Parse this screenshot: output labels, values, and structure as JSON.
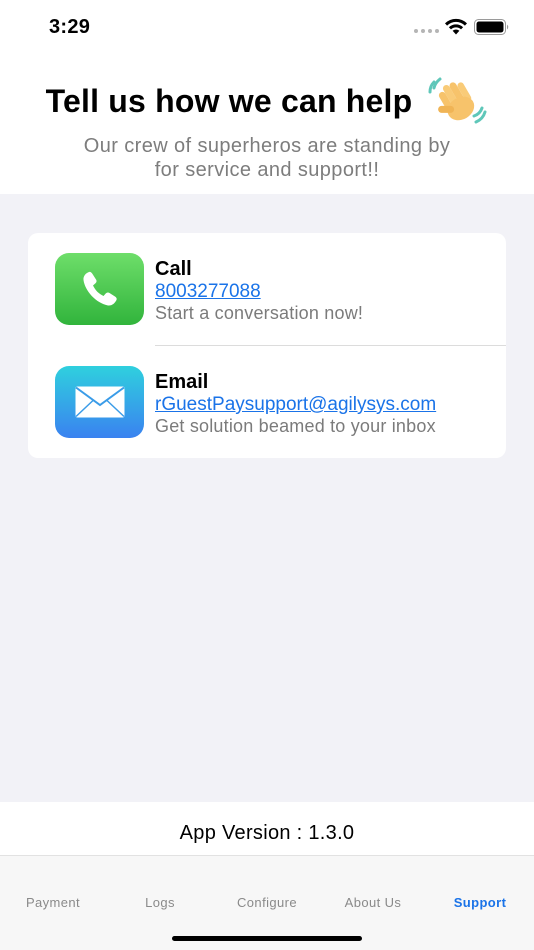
{
  "status_bar": {
    "time": "3:29"
  },
  "header": {
    "title": "Tell us how we can help",
    "subtitle_line1": "Our crew of superheros are standing by",
    "subtitle_line2": "for service and support!!"
  },
  "contacts": [
    {
      "title": "Call",
      "link": "8003277088",
      "description": "Start a conversation now!",
      "icon": "phone-icon"
    },
    {
      "title": "Email",
      "link": "rGuestPaysupport@agilysys.com",
      "description": "Get solution beamed to your inbox",
      "icon": "mail-icon"
    }
  ],
  "footer": {
    "version": "App Version : 1.3.0"
  },
  "tabs": [
    {
      "label": "Payment",
      "active": false
    },
    {
      "label": "Logs",
      "active": false
    },
    {
      "label": "Configure",
      "active": false
    },
    {
      "label": "About Us",
      "active": false
    },
    {
      "label": "Support",
      "active": true
    }
  ],
  "colors": {
    "accent": "#1a73e8",
    "background": "#f2f2f7",
    "phone_green": "#34c759",
    "mail_blue": "#3a82f0"
  }
}
